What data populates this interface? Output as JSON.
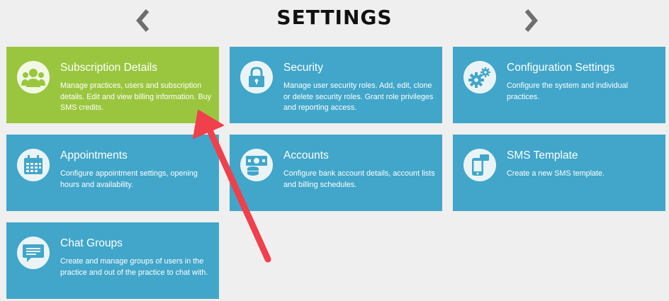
{
  "header": {
    "title": "SETTINGS",
    "prev_icon": "chevron-left-icon",
    "next_icon": "chevron-right-icon"
  },
  "colors": {
    "tile_blue": "#41a6c9",
    "tile_green": "#9ac63f",
    "annotation_arrow": "#f0404b"
  },
  "tiles": [
    {
      "title": "Subscription Details",
      "description": "Manage practices, users and subscription details. Edit and view billing information. Buy SMS credits.",
      "icon": "users-icon",
      "highlighted": true
    },
    {
      "title": "Security",
      "description": "Manage user security roles. Add, edit, clone or delete security roles. Grant role privileges and reporting access.",
      "icon": "lock-icon"
    },
    {
      "title": "Configuration Settings",
      "description": "Configure the system and individual practices.",
      "icon": "gears-icon"
    },
    {
      "title": "Appointments",
      "description": "Configure appointment settings, opening hours and availability.",
      "icon": "calendar-icon"
    },
    {
      "title": "Accounts",
      "description": "Configure bank account details, account lists and billing schedules.",
      "icon": "money-icon"
    },
    {
      "title": "SMS Template",
      "description": "Create a new SMS template.",
      "icon": "mobile-icon"
    },
    {
      "title": "Chat Groups",
      "description": "Create and manage groups of users in the practice and out of the practice to chat with.",
      "icon": "chat-icon"
    }
  ]
}
